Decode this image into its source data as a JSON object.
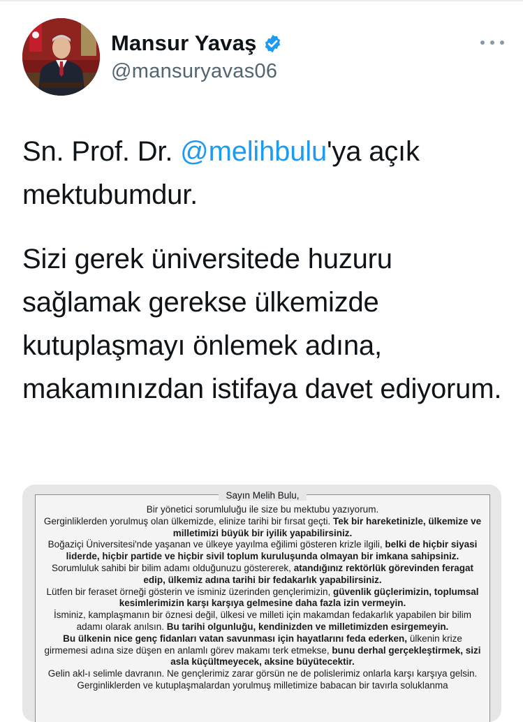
{
  "tweet": {
    "author_name": "Mansur Yavaş",
    "handle": "@mansuryavas06",
    "text_part1_before": "Sn. Prof. Dr. ",
    "mention": "@melihbulu",
    "text_part1_after": "'ya açık mektubumdur.",
    "text_part2": "Sizi gerek üniversitede huzuru sağlamak gerekse ülkemizde kutuplaşmayı önlemek adına, makamınızdan istifaya davet ediyorum."
  },
  "colors": {
    "mention": "#1d9bf0",
    "verified": "#1d9bf0",
    "handle": "#536471"
  },
  "icons": {
    "verified": "verified-badge-icon",
    "more": "more-options-icon"
  },
  "letter": {
    "greeting": "Sayın Melih Bulu,",
    "p1": "Bir yönetici sorumluluğu ile size bu mektubu yazıyorum.",
    "p2_normal": "Gerginliklerden yorulmuş olan ülkemizde, elinize tarihi bir fırsat geçti. ",
    "p2_bold": "Tek bir hareketinizle, ülkemize ve milletimizi büyük bir iyilik yapabilirsiniz.",
    "p3_normal": "Boğaziçi Üniversitesi'nde yaşanan ve ülkeye yayılma eğilimi gösteren krizle ilgili, ",
    "p3_bold": "belki de hiçbir siyasi liderde, hiçbir partide ve hiçbir sivil toplum kuruluşunda olmayan bir imkana sahipsiniz.",
    "p4_normal": "Sorumluluk sahibi bir bilim adamı olduğunuzu göstererek, ",
    "p4_bold": "atandığınız rektörlük görevinden feragat edip, ülkemiz adına tarihi bir fedakarlık yapabilirsiniz.",
    "p5_normal": "Lütfen bir feraset örneği gösterin ve isminiz üzerinden gençlerimizin, ",
    "p5_bold": "güvenlik güçlerimizin, toplumsal kesimlerimizin karşı karşıya gelmesine daha fazla izin vermeyin.",
    "p6_normal": "İsminiz, kamplaşmanın bir öznesi değil, ülkesi ve milleti için makamdan fedakarlık yapabilen bir bilim adamı olarak anılsın. ",
    "p6_bold": "Bu tarihi olgunluğu, kendinizden ve milletimizden esirgemeyin.",
    "p7_bold1": "Bu ülkenin nice genç fidanları vatan savunması için hayatlarını feda ederken,",
    "p7_normal": " ülkenin krize girmemesi adına size düşen en anlamlı görev makamı terk etmekse, ",
    "p7_bold2": "bunu derhal gerçekleştirmek, sizi asla küçültmeyecek, aksine büyütecektir.",
    "p8": "Gelin akl-ı selimle davranın. Ne gençlerimiz zarar görsün ne de polislerimiz onlarla karşı karşıya gelsin.",
    "p9": "Gerginliklerden ve kutuplaşmalardan yorulmuş milletimize babacan bir tavırla soluklanma"
  }
}
